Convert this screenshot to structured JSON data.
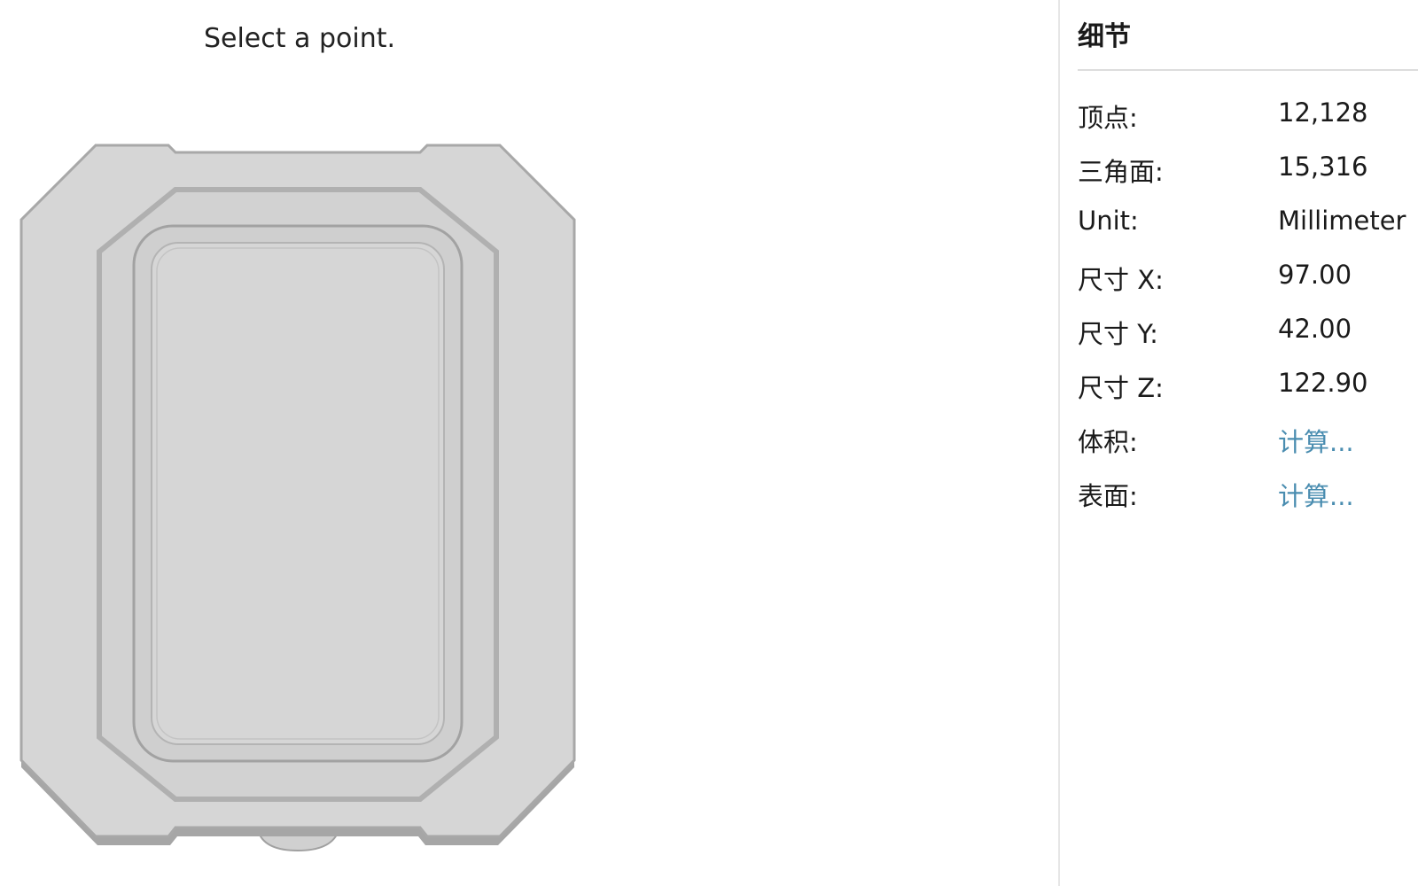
{
  "viewport": {
    "hint": "Select a point."
  },
  "panel": {
    "title": "细节",
    "rows": [
      {
        "label": "顶点:",
        "value": "12,128"
      },
      {
        "label": "三角面:",
        "value": "15,316"
      },
      {
        "label": "Unit:",
        "value": "Millimeter"
      },
      {
        "label": "尺寸 X:",
        "value": "97.00"
      },
      {
        "label": "尺寸 Y:",
        "value": "42.00"
      },
      {
        "label": "尺寸 Z:",
        "value": "122.90"
      },
      {
        "label": "体积:",
        "value": "计算..."
      },
      {
        "label": "表面:",
        "value": "计算..."
      }
    ]
  },
  "colors": {
    "model_fill": "#d4d4d4",
    "model_edge": "#a8a8a8",
    "link": "#4a8db0",
    "divider": "#e6e6e6"
  }
}
